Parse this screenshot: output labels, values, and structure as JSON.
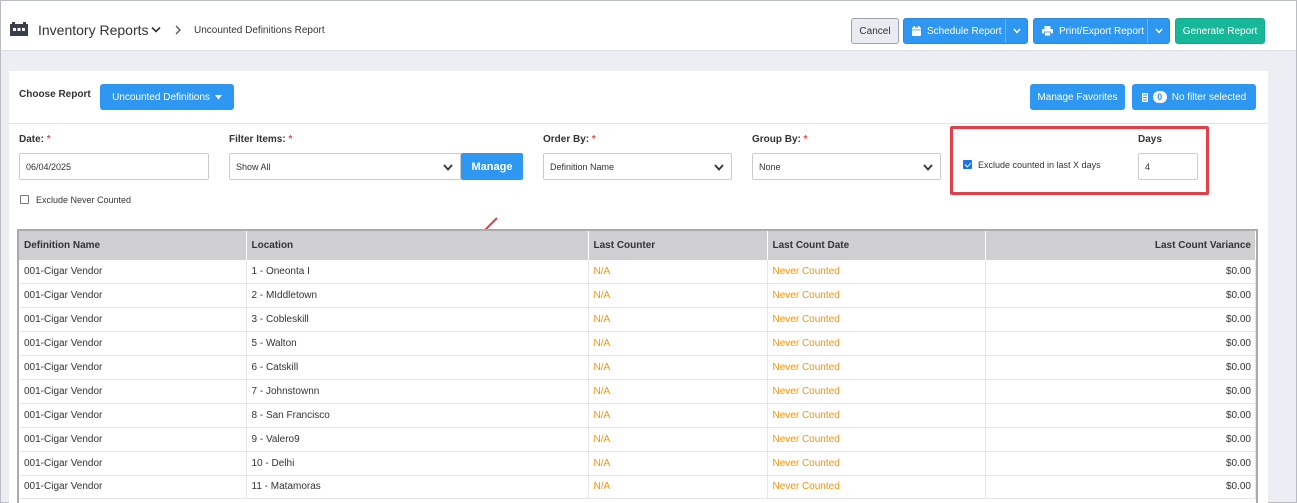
{
  "header": {
    "app_title": "Inventory Reports",
    "breadcrumb": "Uncounted Definitions Report",
    "cancel_label": "Cancel",
    "schedule_label": "Schedule Report",
    "print_label": "Print/Export Report",
    "generate_label": "Generate Report"
  },
  "toolbar": {
    "choose_label": "Choose Report",
    "report_selected": "Uncounted Definitions",
    "favorites_label": "Manage Favorites",
    "filter_count": "0",
    "filter_label": "No filter selected"
  },
  "filters": {
    "date_label": "Date:",
    "date_value": "06/04/2025",
    "filter_items_label": "Filter Items:",
    "filter_items_value": "Show All",
    "manage_label": "Manage",
    "order_by_label": "Order By:",
    "order_by_value": "Definition Name",
    "group_by_label": "Group By:",
    "group_by_value": "None",
    "required_marker": "*",
    "exclude_recent_label": "Exclude counted in last X days",
    "exclude_recent_checked": true,
    "days_label": "Days",
    "days_value": "4",
    "exclude_never_label": "Exclude Never Counted",
    "exclude_never_checked": false
  },
  "table": {
    "columns": [
      "Definition Name",
      "Location",
      "Last Counter",
      "Last Count Date",
      "Last Count Variance"
    ],
    "rows": [
      [
        "001-Cigar Vendor",
        "1 - Oneonta I",
        "N/A",
        "Never Counted",
        "$0.00"
      ],
      [
        "001-Cigar Vendor",
        "2 - MIddletown",
        "N/A",
        "Never Counted",
        "$0.00"
      ],
      [
        "001-Cigar Vendor",
        "3 - Cobleskill",
        "N/A",
        "Never Counted",
        "$0.00"
      ],
      [
        "001-Cigar Vendor",
        "5 - Walton",
        "N/A",
        "Never Counted",
        "$0.00"
      ],
      [
        "001-Cigar Vendor",
        "6 - Catskill",
        "N/A",
        "Never Counted",
        "$0.00"
      ],
      [
        "001-Cigar Vendor",
        "7 - Johnstownn",
        "N/A",
        "Never Counted",
        "$0.00"
      ],
      [
        "001-Cigar Vendor",
        "8 - San Francisco",
        "N/A",
        "Never Counted",
        "$0.00"
      ],
      [
        "001-Cigar Vendor",
        "9 - Valero9",
        "N/A",
        "Never Counted",
        "$0.00"
      ],
      [
        "001-Cigar Vendor",
        "10 - Delhi",
        "N/A",
        "Never Counted",
        "$0.00"
      ],
      [
        "001-Cigar Vendor",
        "11 - Matamoras",
        "N/A",
        "Never Counted",
        "$0.00"
      ]
    ]
  },
  "colors": {
    "primary_blue": "#2e97f2",
    "generate_green": "#17b79a",
    "warning_orange": "#f0960e",
    "highlight_red": "#e0404a"
  }
}
